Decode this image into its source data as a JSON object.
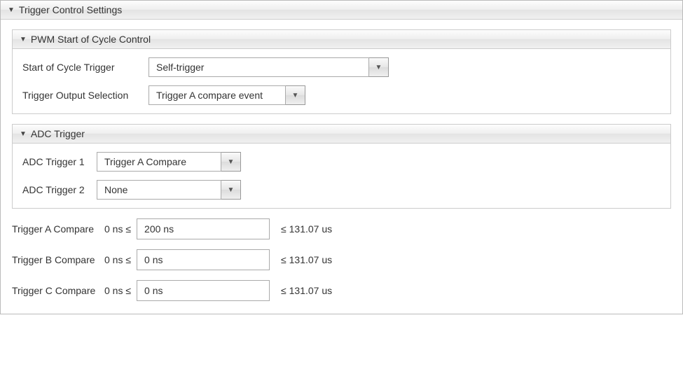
{
  "outer": {
    "title": "Trigger Control Settings"
  },
  "pwm": {
    "title": "PWM Start of Cycle Control",
    "start_label": "Start of Cycle Trigger",
    "start_value": "Self-trigger",
    "output_label": "Trigger Output Selection",
    "output_value": "Trigger A compare event"
  },
  "adc": {
    "title": "ADC Trigger",
    "trig1_label": "ADC Trigger 1",
    "trig1_value": "Trigger A Compare",
    "trig2_label": "ADC Trigger 2",
    "trig2_value": "None"
  },
  "compare": {
    "a": {
      "label": "Trigger A Compare",
      "min": "0 ns  ≤",
      "value": "200 ns",
      "max": "≤  131.07 us"
    },
    "b": {
      "label": "Trigger B Compare",
      "min": "0 ns  ≤",
      "value": "0 ns",
      "max": "≤  131.07 us"
    },
    "c": {
      "label": "Trigger C Compare",
      "min": "0 ns  ≤",
      "value": "0 ns",
      "max": "≤  131.07 us"
    }
  }
}
